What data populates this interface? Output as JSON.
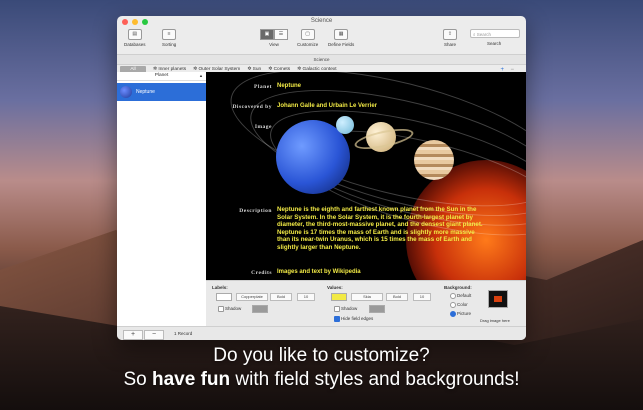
{
  "window": {
    "title": "Science"
  },
  "traffic_lights": {
    "close": "#fe5f57",
    "minimize": "#febc2e",
    "zoom": "#28c840"
  },
  "toolbar": {
    "databases": "Databases",
    "sorting": "Sorting",
    "view": "View",
    "customize": "Customize",
    "define_fields": "Define Fields",
    "share": "Share",
    "search_label": "Search",
    "search_placeholder": "Search"
  },
  "database_bar": {
    "name": "Science"
  },
  "tabs": [
    {
      "label": "All"
    },
    {
      "label": "Inner planets"
    },
    {
      "label": "Outer Solar System"
    },
    {
      "label": "Sun"
    },
    {
      "label": "Comets"
    },
    {
      "label": "Galactic context"
    }
  ],
  "tab_actions": {
    "add": "+",
    "remove": "−"
  },
  "sidebar": {
    "header": "Planet",
    "items": [
      {
        "label": "Neptune",
        "selected": true
      }
    ]
  },
  "record": {
    "planet_label": "Planet",
    "planet_value": "Neptune",
    "discovered_label": "Discovered by",
    "discovered_value": "Johann Galle and Urbain Le Verrier",
    "image_label": "Image",
    "description_label": "Description",
    "description_value": "Neptune is the eighth and farthest known planet from the Sun in the Solar System. In the Solar System, it is the fourth-largest planet by diameter, the third-most-massive planet, and the densest giant planet. Neptune is 17 times the mass of Earth and is slightly more massive than its near-twin Uranus, which is 15 times the mass of Earth and slightly larger than Neptune.",
    "credits_label": "Credits",
    "credits_value": "Images and text by Wikipedia"
  },
  "colors": {
    "value_text": "#f2ea45",
    "selection": "#2c6ed8"
  },
  "properties": {
    "labels": {
      "title": "Labels:",
      "font": "Copperplate",
      "weight": "Bold",
      "size": "10",
      "shadow": "Shadow"
    },
    "values": {
      "title": "Values:",
      "font": "Skia",
      "weight": "Bold",
      "size": "10",
      "shadow": "Shadow",
      "hide_edges": "Hide field edges"
    },
    "background": {
      "title": "Background:",
      "options": [
        "Default",
        "Color",
        "Picture"
      ],
      "selected": "Picture",
      "drag_hint": "Drag image here"
    }
  },
  "bottom_bar": {
    "add": "+",
    "remove": "−",
    "record_count": "1 Record"
  },
  "caption": {
    "line1": "Do you like to customize?",
    "line2_prefix": "So ",
    "line2_bold": "have fun",
    "line2_suffix": " with field styles and backgrounds!"
  }
}
